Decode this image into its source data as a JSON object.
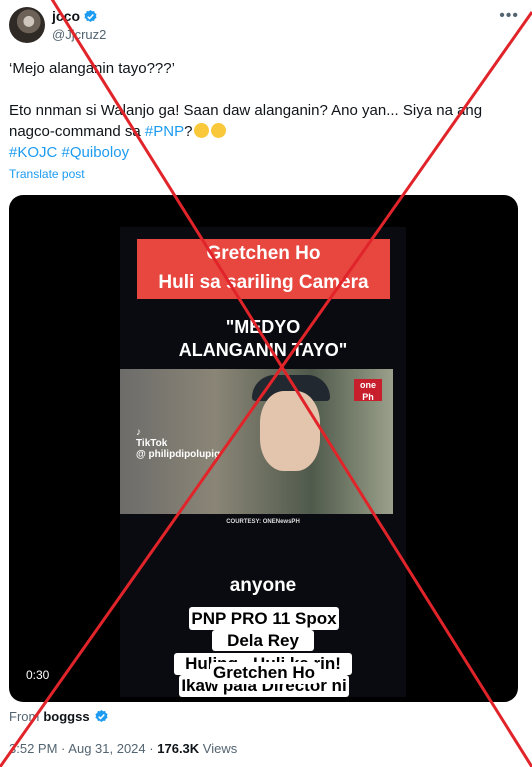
{
  "author": {
    "name": "jcco",
    "handle": "@Jjcruz2",
    "verified_icon": "verified-badge-icon",
    "more_icon": "more-options-icon"
  },
  "tweet": {
    "line1": "‘Mejo alanganin tayo???’",
    "line2": "Eto nnman si Walanjo ga! Saan daw alanganin? Ano yan... Siya na ang nagco-command sa ",
    "pnp_tag": "#PNP",
    "line2_end": "?",
    "tags": [
      "#KOJC",
      "#Quiboloy"
    ],
    "translate": "Translate post"
  },
  "video": {
    "headline1": "Gretchen Ho",
    "headline2": "Huli sa sariling Camera",
    "quote1": "\"MEDYO",
    "quote2": "ALANGANIN TAYO\"",
    "logo_text": "one",
    "logo_sub": "Ph",
    "tiktok_label": "TikTok",
    "tiktok_user": "@ philipdipolupig",
    "courtesy": "COURTESY: ONENewsPH",
    "caption_anyone": "anyone",
    "box1": "PNP PRO 11 Spox",
    "box2": "Dela Rey",
    "box3": "Huling - Huli ka rin!",
    "box4": "Ikaw pala Director ni",
    "box5": "Gretchen Ho",
    "duration": "0:30"
  },
  "source": {
    "from_label": "From",
    "from_user": "boggss"
  },
  "meta": {
    "time": "3:52 PM",
    "date": "Aug 31, 2024",
    "views_count": "176.3K",
    "views_label": "Views",
    "separator": "·"
  },
  "colors": {
    "accent": "#1d9bf0",
    "banner_red": "#e8473f",
    "cross_red": "#e0242a"
  }
}
